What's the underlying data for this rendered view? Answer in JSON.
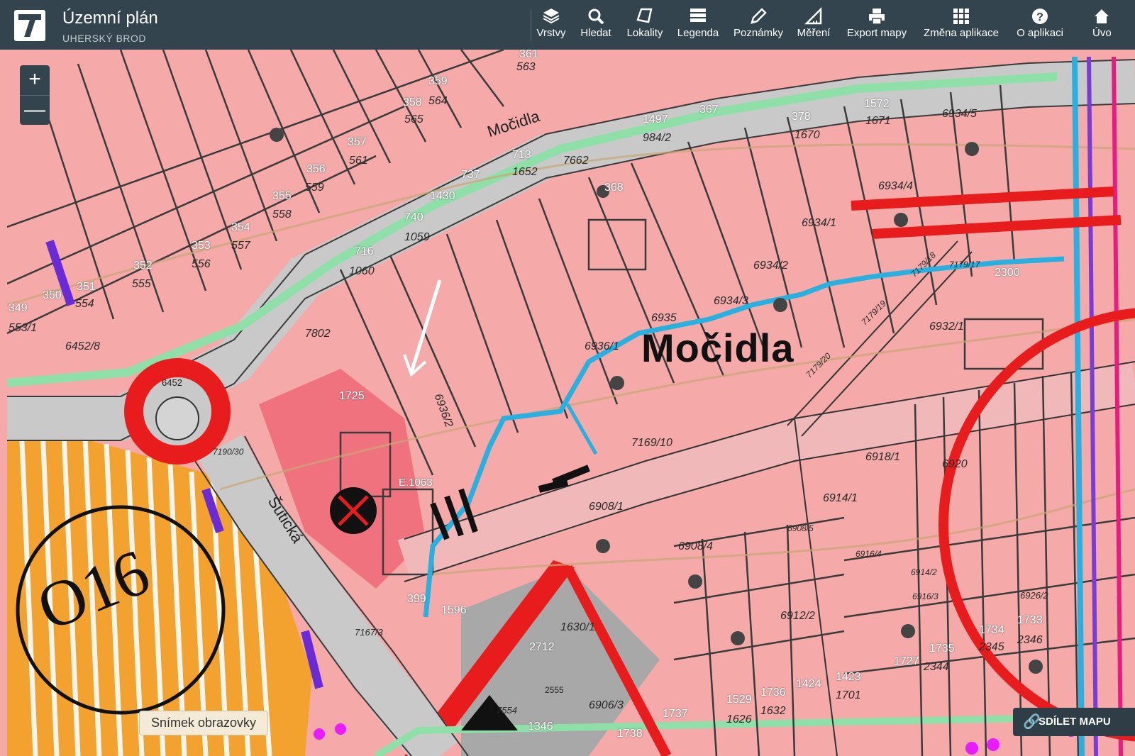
{
  "header": {
    "title": "Územní plán",
    "subtitle": "UHERSKÝ BROD",
    "tools": [
      {
        "label": "Vrstvy",
        "icon": "layers-icon"
      },
      {
        "label": "Hledat",
        "icon": "search-icon"
      },
      {
        "label": "Lokality",
        "icon": "polygon-icon"
      },
      {
        "label": "Legenda",
        "icon": "legend-list-icon"
      },
      {
        "label": "Poznámky",
        "icon": "pencil-icon"
      },
      {
        "label": "Měření",
        "icon": "ruler-icon"
      },
      {
        "label": "Export mapy",
        "icon": "printer-icon"
      },
      {
        "label": "Změna aplikace",
        "icon": "grid-icon"
      },
      {
        "label": "O aplikaci",
        "icon": "help-icon"
      },
      {
        "label": "Úvo",
        "icon": "home-icon"
      }
    ]
  },
  "map": {
    "zoom_in": "+",
    "zoom_out": "—",
    "locality_name": "Močidla",
    "zone_code": "O16",
    "street_mocidla": "Močidla",
    "street_suticka": "Šutická",
    "labels_top": [
      "361",
      "563",
      "359",
      "564",
      "358",
      "565",
      "357",
      "561",
      "356",
      "559",
      "355",
      "558",
      "354",
      "557",
      "353",
      "556",
      "352",
      "555",
      "351",
      "554",
      "350",
      "349",
      "553/1",
      "367",
      "1497",
      "1572",
      "378",
      "6934/5",
      "713",
      "737",
      "1430",
      "740",
      "716",
      "368",
      "6934/4",
      "6934/1",
      "6934/2",
      "6934/3",
      "2300",
      "6932/1",
      "7802",
      "6452/8",
      "6452",
      "1725",
      "7190/30",
      "E.1063",
      "6908/1",
      "7169/10",
      "6918/1",
      "6920",
      "6914/1",
      "6908/5",
      "6908/4",
      "6916/4",
      "6914/2",
      "6916/3",
      "6926/2",
      "6912/2",
      "399",
      "1596",
      "2712",
      "1630/1",
      "1734",
      "1733",
      "1735",
      "1727",
      "1423",
      "1424",
      "1736",
      "1529",
      "1737",
      "1738",
      "1346",
      "7554",
      "7167/3",
      "7179/18",
      "7179/17",
      "7179/19",
      "7179/20",
      "6936/1",
      "1670",
      "1671",
      "1652",
      "7662",
      "984/2",
      "2346",
      "2345",
      "2344",
      "1701",
      "1626",
      "1632",
      "6906/3",
      "2555",
      "6936/2",
      "6935",
      "1060",
      "1059"
    ],
    "snapshot_label": "Snímek obrazovky",
    "share_label": "SDÍLET MAPU",
    "colors": {
      "header": "#34444e",
      "residential": "#f5a9a9",
      "road": "#c9c9c9",
      "water": "#27b0e0",
      "zone_orange": "#f3a22f",
      "red_line": "#e81c1c",
      "green_strip": "#8ee0a8"
    }
  }
}
